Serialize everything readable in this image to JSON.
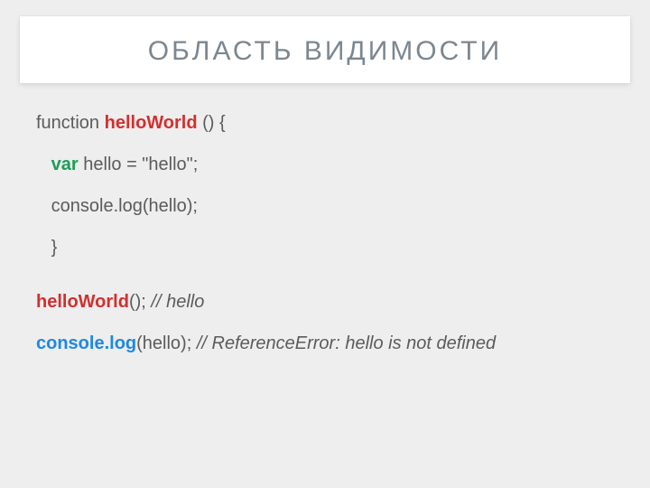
{
  "title": "ОБЛАСТЬ ВИДИМОСТИ",
  "code": {
    "l1a": "function ",
    "l1b": "helloWorld",
    "l1c": " () {",
    "l2a": "   ",
    "l2b": "var",
    "l2c": " hello = \"hello\";",
    "l3": "   console.log(hello);",
    "l4": "   }",
    "l5a": "helloWorld",
    "l5b": "(); ",
    "l5c": "// hello",
    "l6a": "console.log",
    "l6b": "(hello); ",
    "l6c": "// ReferenceError: hello is not defined"
  }
}
